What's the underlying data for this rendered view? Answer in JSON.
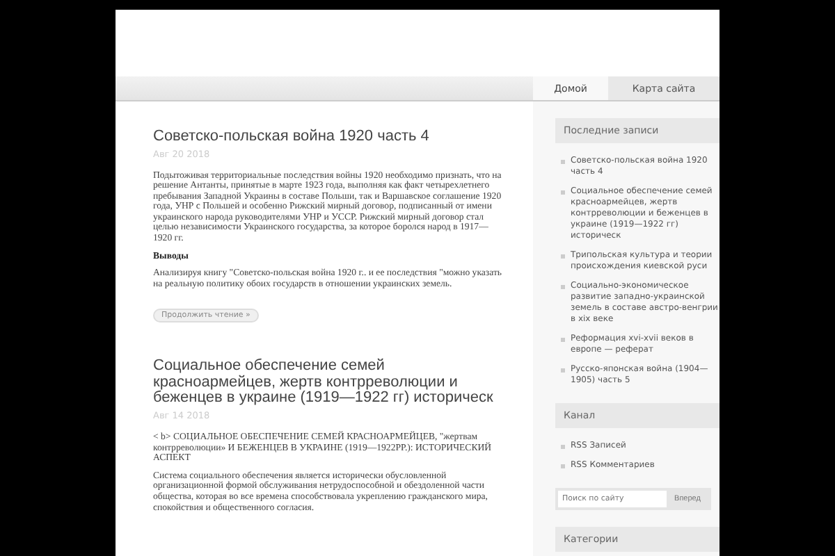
{
  "nav": {
    "tabs": [
      {
        "label": "Домой",
        "selected": true
      },
      {
        "label": "Карта сайта",
        "selected": false
      }
    ]
  },
  "posts": [
    {
      "title": "Советско-польская война 1920 часть 4",
      "date": "Авг 20 2018",
      "blocks": [
        {
          "kind": "paragraph",
          "text": "Подытоживая территориальные последствия войны 1920 необходимо признать, что на решение Антанты, принятые в марте 1923 года, выполняя как факт четырехлетнего пребывания Западной Украины в составе Польши, так и Варшавское соглашение 1920 года, УНР с Польшей и особенно Рижский мирный договор, подписанный от имени украинского народа руководителями УНР и УССР. Рижский мирный договор стал целью независимости Украинского государства, за которое боролся народ в 1917—1920 гг."
        },
        {
          "kind": "heading",
          "text": "Выводы"
        },
        {
          "kind": "paragraph",
          "text": "Анализируя книгу \"Советско-польская война 1920 г.. и ее последствия \"можно указать на реальную политику обоих государств в отношении украинских земель."
        },
        {
          "kind": "more",
          "text": "Продолжить чтение »"
        }
      ]
    },
    {
      "title": "Социальное обеспечение семей красноармейцев, жертв контрреволюции и беженцев в украине (1919—1922 гг) историческ",
      "date": "Авг 14 2018",
      "blocks": [
        {
          "kind": "paragraph",
          "text": "< b> СОЦИАЛЬНОЕ ОБЕСПЕЧЕНИЕ СЕМЕЙ КРАСНОАРМЕЙЦЕВ, \"жертвам контрреволюции» И БЕЖЕНЦЕВ В УКРАИНЕ (1919—1922РР.): ИСТОРИЧЕСКИЙ АСПЕКТ"
        },
        {
          "kind": "paragraph",
          "text": "Система социального обеспечения является исторически обусловленной организационной формой обслуживания нетрудоспособной и обездоленной части общества, которая во все времена способствовала укреплению гражданского мира, спокойствия и общественного согласия."
        }
      ]
    }
  ],
  "sidebar": {
    "recent": {
      "title": "Последние записи",
      "items": [
        "Советско-польская война 1920 часть 4",
        "Социальное обеспечение семей красноармейцев, жертв контрреволюции и беженцев в украине (1919—1922 гг) историческ",
        "Трипольская культура и теории происхождения киевской руси",
        "Социально-экономическое развитие западно-украинской земель в составе австро-венгрии в xix веке",
        "Реформация xvi-xvii веков в европе — реферат",
        "Русско-японская война (1904—1905) часть 5"
      ]
    },
    "feed": {
      "title": "Канал",
      "items": [
        "RSS Записей",
        "RSS Комментариев"
      ]
    },
    "search": {
      "placeholder": "Поиск по сайту",
      "button": "Вперед"
    },
    "categories": {
      "title": "Категории"
    }
  }
}
